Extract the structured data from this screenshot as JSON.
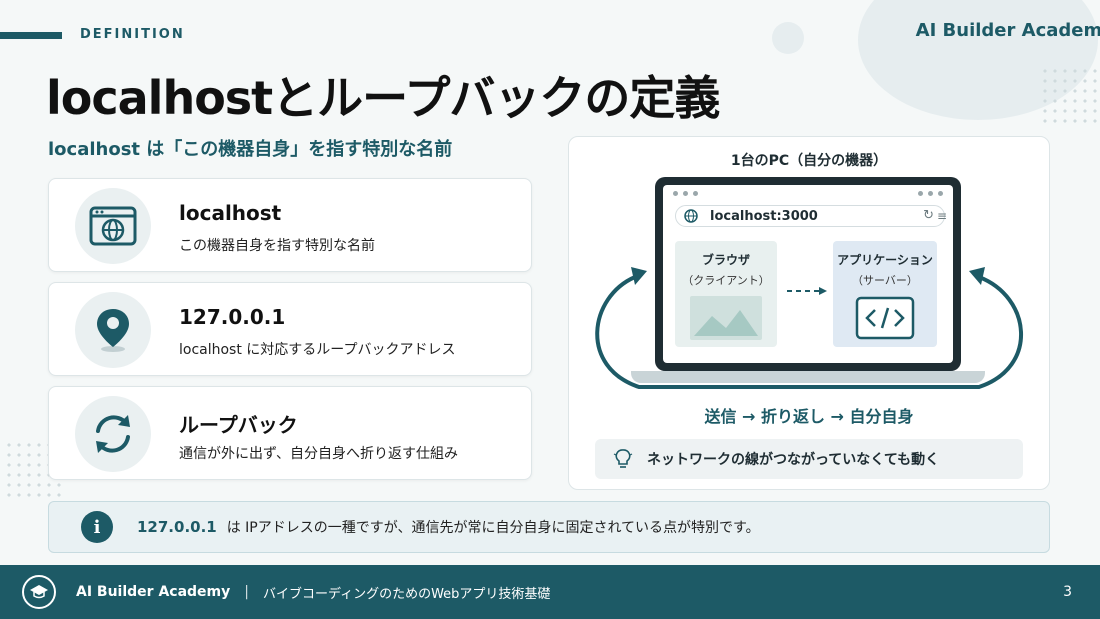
{
  "header": {
    "section_label": "DEFINITION",
    "brand": "AI Builder Academy",
    "title": "localhostとループバックの定義",
    "subtitle": "localhost は「この機器自身」を指す特別な名前"
  },
  "cards": [
    {
      "title": "localhost",
      "description": "この機器自身を指す特別な名前",
      "icon": "browser-globe-icon"
    },
    {
      "title": "127.0.0.1",
      "description": "localhost に対応するループバックアドレス",
      "icon": "location-pin-icon"
    },
    {
      "title": "ループバック",
      "description": "通信が外に出ず、自分自身へ折り返す仕組み",
      "icon": "sync-arrows-icon"
    }
  ],
  "diagram": {
    "pc_label": "1台のPC（自分の機器）",
    "url": "localhost:3000",
    "browser_title": "ブラウザ",
    "browser_sub": "（クライアント）",
    "app_title": "アプリケーション",
    "app_sub": "（サーバー）",
    "flow": "送信 → 折り返し → 自分自身",
    "note": "ネットワークの線がつながっていなくても動く"
  },
  "info": {
    "key": "127.0.0.1",
    "text": "は IPアドレスの一種ですが、通信先が常に自分自身に固定されている点が特別です。"
  },
  "footer": {
    "brand": "AI Builder Academy",
    "separator": "|",
    "course": "バイブコーディングのためのWebアプリ技術基礎",
    "page": "3"
  },
  "colors": {
    "accent": "#1d5a66",
    "background": "#f5f8f8",
    "icon_accent": "#1d5a66"
  }
}
